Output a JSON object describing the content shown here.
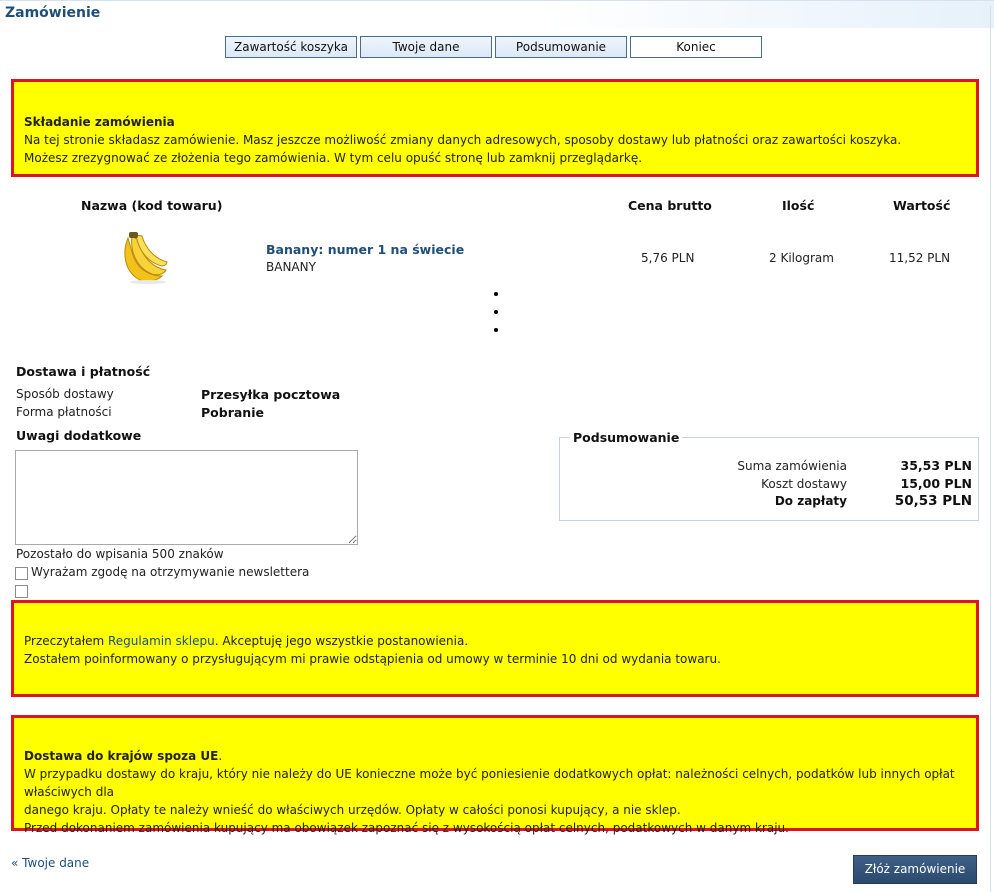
{
  "page": {
    "title": "Zamówienie"
  },
  "steps": [
    {
      "label": "Zawartość koszyka"
    },
    {
      "label": "Twoje dane"
    },
    {
      "label": "Podsumowanie"
    },
    {
      "label": "Koniec"
    }
  ],
  "notice_order": {
    "heading": "Składanie zamówienia",
    "line1": "Na tej stronie składasz zamówienie. Masz jeszcze możliwość zmiany danych adresowych, sposoby dostawy lub płatności oraz zawartości koszyka.",
    "line2": "Możesz zrezygnować ze złożenia tego zamówienia. W tym celu opuść stronę lub zamknij przeglądarkę."
  },
  "table": {
    "headers": {
      "name": "Nazwa (kod towaru)",
      "price": "Cena brutto",
      "qty": "Ilość",
      "value": "Wartość"
    },
    "rows": [
      {
        "name": "Banany: numer 1 na świecie",
        "code": "BANANY",
        "price": "5,76 PLN",
        "qty": "2 Kilogram",
        "value": "11,52 PLN",
        "image_icon": "banana-image"
      }
    ]
  },
  "delivery": {
    "title": "Dostawa i płatność",
    "shipping_label": "Sposób dostawy",
    "shipping_value": "Przesyłka pocztowa",
    "payment_label": "Forma płatności",
    "payment_value": "Pobranie"
  },
  "notes": {
    "title": "Uwagi dodatkowe",
    "value": "",
    "remaining": "Pozostało do wpisania 500 znaków"
  },
  "newsletter": {
    "label": "Wyrażam zgodę na otrzymywanie newslettera",
    "checked": false
  },
  "terms": {
    "checked": false,
    "prefix": "Przeczytałem ",
    "link": "Regulamin sklepu",
    "suffix": ". Akceptuję jego wszystkie postanowienia.",
    "line2": "Zostałem poinformowany o przysługującym mi prawie odstąpienia od umowy w terminie 10 dni od wydania towaru."
  },
  "summary": {
    "title": "Podsumowanie",
    "order_sum_label": "Suma zamówienia",
    "order_sum_value": "35,53 PLN",
    "shipping_cost_label": "Koszt dostawy",
    "shipping_cost_value": "15,00 PLN",
    "total_label": "Do zapłaty",
    "total_value": "50,53 PLN"
  },
  "notice_eu": {
    "heading": "Dostawa do krajów spoza UE",
    "heading_suffix": ".",
    "line1": "W przypadku dostawy do kraju, który nie należy do UE konieczne może być poniesienie dodatkowych opłat: należności celnych, podatków lub innych opłat właściwych dla",
    "line2": "danego kraju. Opłaty te należy wnieść do właściwych urzędów. Opłaty w całości ponosi kupujący, a nie sklep.",
    "line3": "Przed dokonaniem zamówienia kupujący ma obowiązek zapoznać się z wysokością opłat celnych, podatkowych w danym kraju."
  },
  "footer": {
    "back_link": "« Twoje dane",
    "submit_label": "Złóż zamówienie"
  },
  "colors": {
    "notice_bg": "#ffff00",
    "notice_border": "#e0141e",
    "link": "#1f4e79",
    "button": "#2c4a70"
  }
}
